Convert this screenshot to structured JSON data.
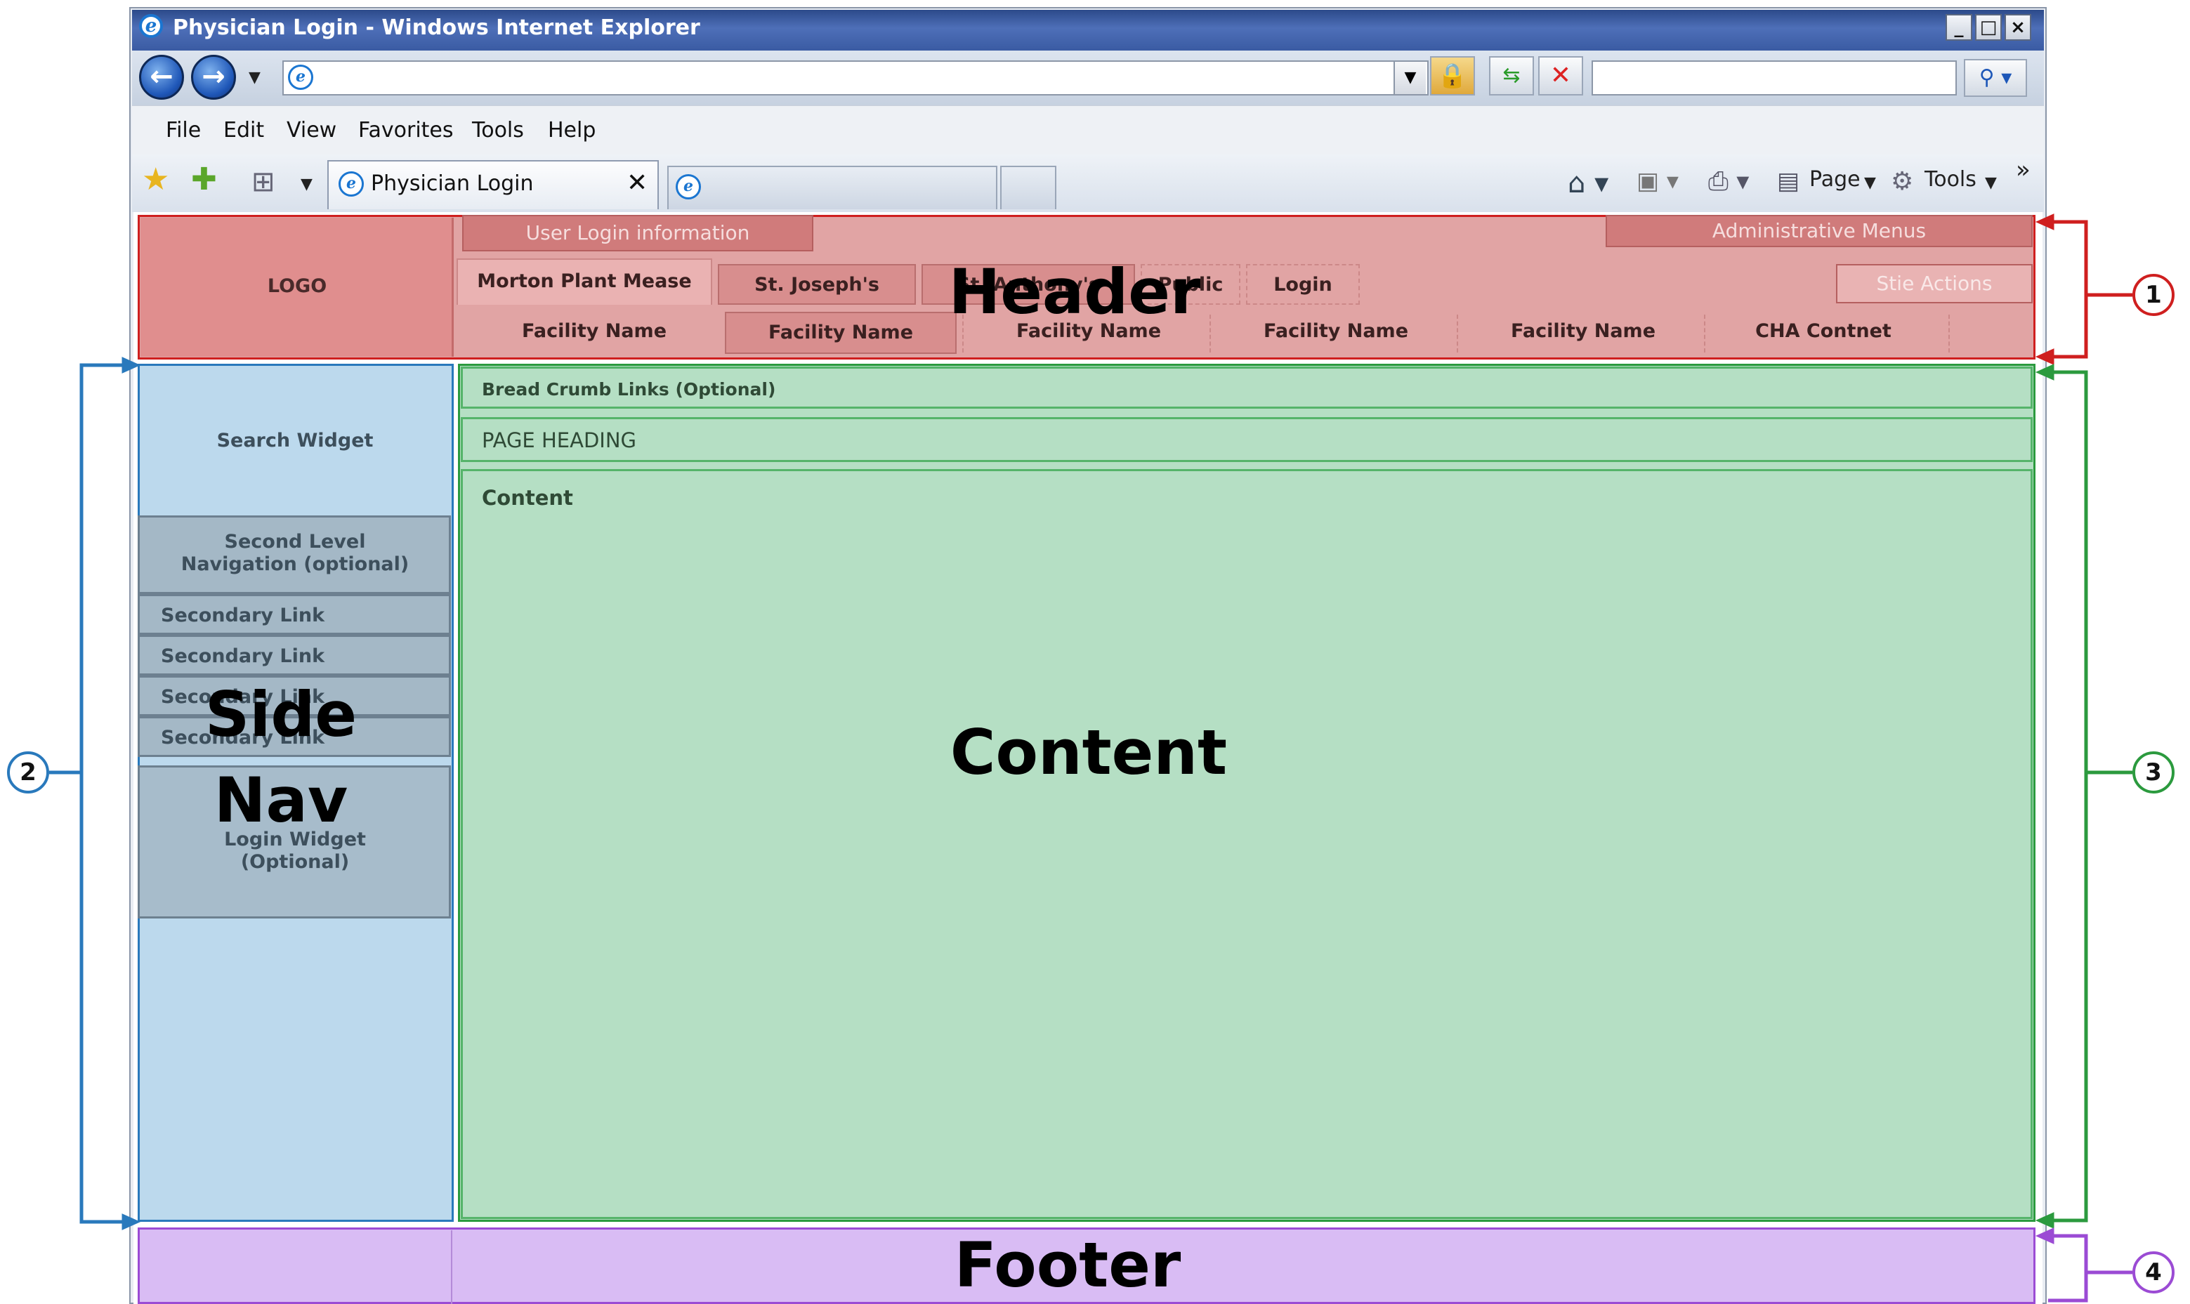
{
  "browser": {
    "window_title": "Physician Login - Windows Internet Explorer",
    "menu": [
      "File",
      "Edit",
      "View",
      "Favorites",
      "Tools",
      "Help"
    ],
    "active_tab": "Physician Login",
    "page_menu": "Page",
    "tools_menu": "Tools",
    "overflow": "»"
  },
  "header": {
    "logo": "LOGO",
    "user_login_bar": "User Login information",
    "admin_menus_bar": "Administrative Menus",
    "site_actions": "Stie Actions",
    "facility_tabs": [
      "Morton Plant Mease",
      "St. Joseph's",
      "St. Anthony's",
      "Public",
      "Login"
    ],
    "facility_row": [
      "Facility Name",
      "Facility Name",
      "Facility Name",
      "Facility Name",
      "Facility Name",
      "CHA Contnet"
    ],
    "region_label": "Header"
  },
  "sidenav": {
    "search_widget": "Search Widget",
    "second_level_nav_line1": "Second Level",
    "second_level_nav_line2": "Navigation (optional)",
    "secondary_links": [
      "Secondary Link",
      "Secondary Link",
      "Secondary Link",
      "Secondary Link"
    ],
    "login_widget_line1": "Login Widget",
    "login_widget_line2": "(Optional)",
    "region_label_line1": "Side",
    "region_label_line2": "Nav"
  },
  "content": {
    "breadcrumb": "Bread Crumb Links (Optional)",
    "page_heading": "PAGE HEADING",
    "content_label": "Content",
    "region_label": "Content"
  },
  "footer": {
    "region_label": "Footer"
  },
  "callouts": {
    "c1": "1",
    "c2": "2",
    "c3": "3",
    "c4": "4",
    "colors": {
      "header": "#cf1f1f",
      "sidenav": "#2979bc",
      "content": "#2b9a3e",
      "footer": "#9b4bd4"
    }
  }
}
